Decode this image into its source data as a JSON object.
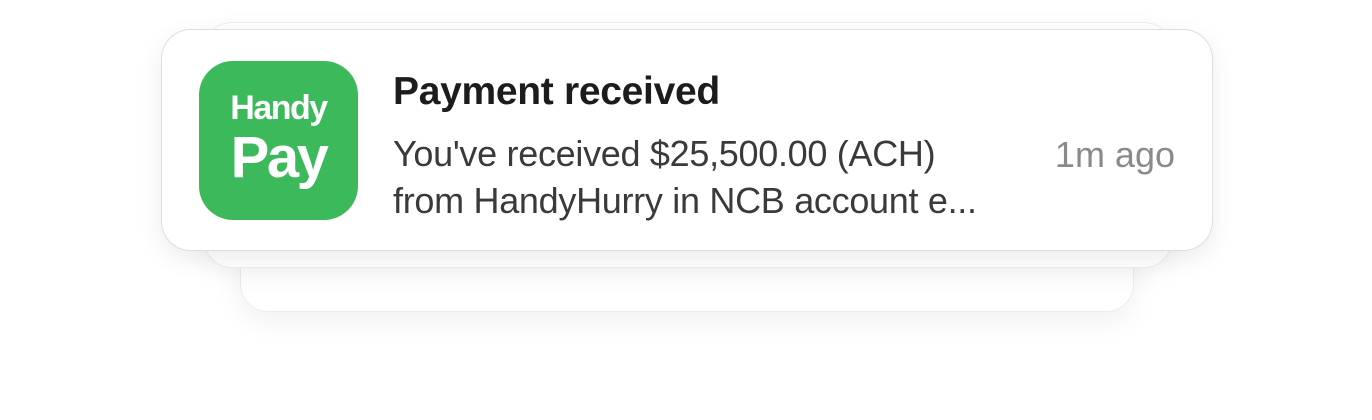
{
  "notification": {
    "app_icon": {
      "icon_name": "handypay-app-icon",
      "top_text": "Handy",
      "bottom_text": "Pay",
      "color": "#3bb95b"
    },
    "title": "Payment received",
    "message_line1": "You've received $25,500.00 (ACH)",
    "message_line2": "from HandyHurry in NCB account e...",
    "timestamp": "1m ago"
  },
  "colors": {
    "title": "#1c1c1c",
    "body": "#3a3a3a",
    "timestamp": "#8a8a8a",
    "card_background": "#ffffff"
  }
}
